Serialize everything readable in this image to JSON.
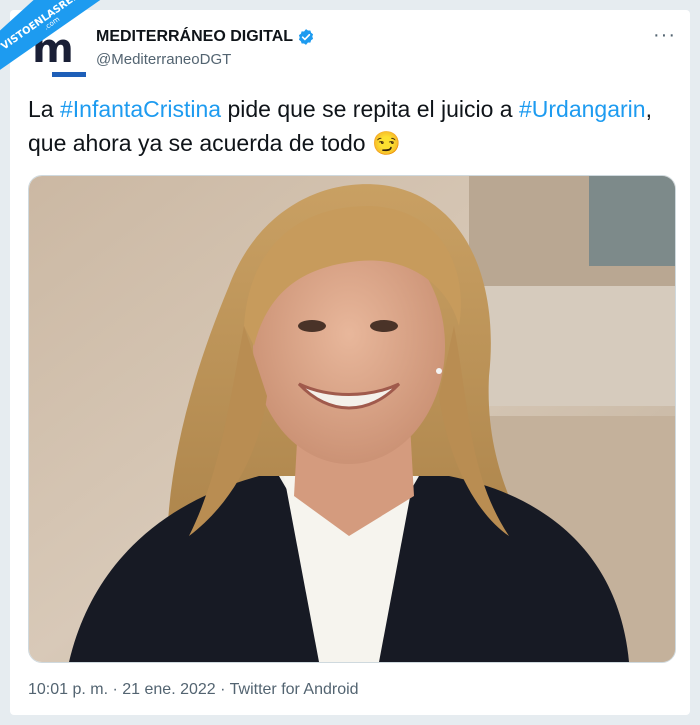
{
  "account": {
    "display_name": "MEDITERRÁNEO DIGITAL",
    "handle": "@MediterraneoDGT",
    "avatar_letter": "m",
    "verified": true
  },
  "more_label": "···",
  "tweet": {
    "text_parts": [
      {
        "text": "La ",
        "type": "plain"
      },
      {
        "text": "#InfantaCristina",
        "type": "hashtag"
      },
      {
        "text": " pide que se repita el juicio a ",
        "type": "plain"
      },
      {
        "text": "#Urdangarin",
        "type": "hashtag"
      },
      {
        "text": ", que ahora ya se acuerda de todo 😏",
        "type": "plain"
      }
    ]
  },
  "meta": {
    "time": "10:01 p. m.",
    "separator": " · ",
    "date": "21 ene. 2022",
    "source": "Twitter for Android"
  },
  "watermark": {
    "line1": "VISTOENLASREDES",
    "line2": ".com"
  },
  "colors": {
    "hashtag": "#1d9bf0",
    "verified": "#1d9bf0",
    "text": "#0f1419",
    "muted": "#536471",
    "page_bg": "#e6ecf0"
  }
}
